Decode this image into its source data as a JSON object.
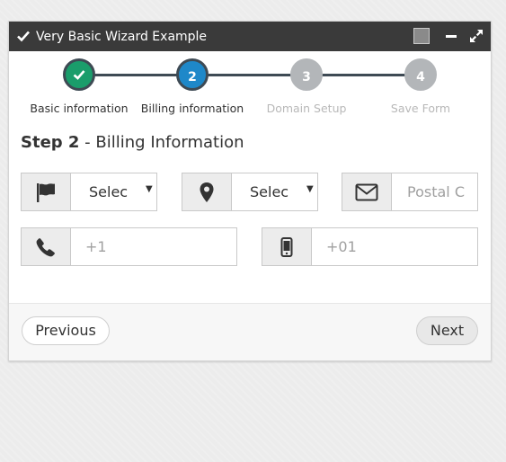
{
  "window": {
    "title": "Very Basic Wizard Example"
  },
  "steps": [
    {
      "number": "",
      "label": "Basic information",
      "state": "done"
    },
    {
      "number": "2",
      "label": "Billing information",
      "state": "active"
    },
    {
      "number": "3",
      "label": "Domain Setup",
      "state": "pending"
    },
    {
      "number": "4",
      "label": "Save Form",
      "state": "pending"
    }
  ],
  "colors": {
    "done": "#1a9d6b",
    "active": "#1e88c9",
    "pending": "#b3b6b9",
    "titlebar": "#3a3a3a"
  },
  "heading": {
    "step": "Step 2",
    "separator": " - ",
    "title": "Billing Information"
  },
  "fields": {
    "country": {
      "value": "Selec",
      "icon": "flag-icon"
    },
    "region": {
      "value": "Selec",
      "icon": "map-marker-icon"
    },
    "postal": {
      "placeholder": "Postal C",
      "icon": "envelope-icon"
    },
    "phone": {
      "placeholder": "+1",
      "icon": "phone-icon"
    },
    "mobile": {
      "placeholder": "+01",
      "icon": "mobile-phone-icon"
    }
  },
  "buttons": {
    "previous": "Previous",
    "next": "Next"
  }
}
